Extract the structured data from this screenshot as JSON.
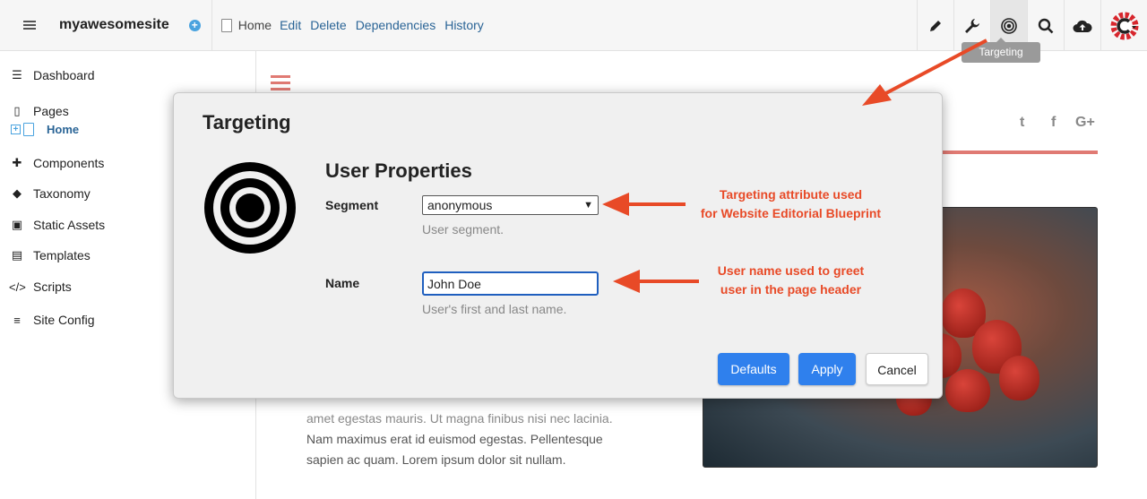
{
  "topbar": {
    "site_name": "myawesomesite",
    "breadcrumb_current": "Home",
    "links": [
      "Edit",
      "Delete",
      "Dependencies",
      "History"
    ],
    "tools": [
      "pencil-icon",
      "wrench-icon",
      "target-icon",
      "search-icon",
      "cloud-upload-icon",
      "crafter-logo-icon"
    ],
    "tooltip": "Targeting"
  },
  "sidebar": {
    "items": [
      {
        "label": "Dashboard",
        "icon": "dashboard-icon"
      },
      {
        "label": "Pages",
        "icon": "file-icon"
      },
      {
        "label": "Components",
        "icon": "puzzle-icon"
      },
      {
        "label": "Taxonomy",
        "icon": "tags-icon"
      },
      {
        "label": "Static Assets",
        "icon": "image-icon"
      },
      {
        "label": "Templates",
        "icon": "file-code-icon"
      },
      {
        "label": "Scripts",
        "icon": "code-icon"
      },
      {
        "label": "Site Config",
        "icon": "sliders-icon"
      }
    ],
    "pages_child": "Home"
  },
  "preview": {
    "text_line1": "amet egestas mauris. Ut magna finibus nisi nec lacinia.",
    "text_line2": "Nam maximus erat id euismod egestas. Pellentesque",
    "text_line3": "sapien ac quam. Lorem ipsum dolor sit nullam.",
    "social": [
      "twitter-icon",
      "facebook-icon",
      "google-plus-icon"
    ]
  },
  "modal": {
    "title": "Targeting",
    "section_title": "User Properties",
    "segment_label": "Segment",
    "segment_value": "anonymous",
    "segment_help": "User segment.",
    "name_label": "Name",
    "name_value": "John Doe",
    "name_help": "User's first and last name.",
    "buttons": {
      "defaults": "Defaults",
      "apply": "Apply",
      "cancel": "Cancel"
    }
  },
  "annotations": {
    "segment_line1": "Targeting attribute used",
    "segment_line2": "for Website Editorial Blueprint",
    "name_line1": "User name used to greet",
    "name_line2": "user in the page header"
  },
  "colors": {
    "accent": "#2f80ed",
    "annotation": "#e84a27",
    "link": "#2a6496"
  }
}
